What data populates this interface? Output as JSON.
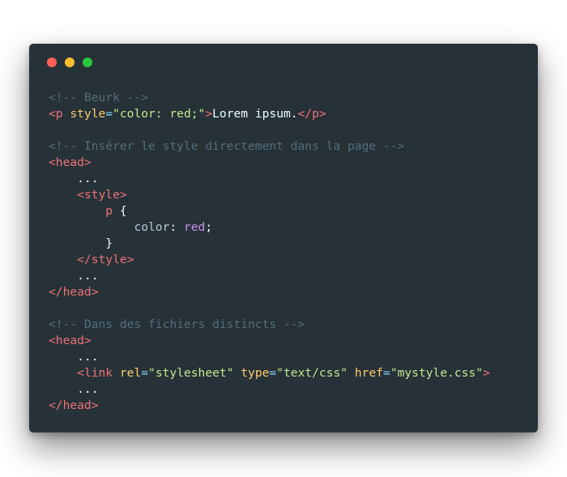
{
  "colors": {
    "background": "#263238",
    "close": "#ff5f56",
    "minimize": "#ffbd2e",
    "maximize": "#27c93f",
    "comment": "#546e7a",
    "tag": "#f07178",
    "attr": "#ffcb6b",
    "string": "#c3e88d",
    "text": "#eeffff",
    "property": "#b2ccd6",
    "value": "#c792ea",
    "punct": "#89ddff"
  },
  "window_controls": [
    "close",
    "minimize",
    "maximize"
  ],
  "code_lines": [
    [
      {
        "t": "<!-- Beurk -->",
        "c": "comment"
      }
    ],
    [
      {
        "t": "<p",
        "c": "tag"
      },
      {
        "t": " style",
        "c": "attr"
      },
      {
        "t": "=",
        "c": "punct"
      },
      {
        "t": "\"color: red;\"",
        "c": "string"
      },
      {
        "t": ">",
        "c": "tag"
      },
      {
        "t": "Lorem ipsum.",
        "c": "text"
      },
      {
        "t": "</p>",
        "c": "tag"
      }
    ],
    [],
    [
      {
        "t": "<!-- Insérer le style directement dans la page -->",
        "c": "comment"
      }
    ],
    [
      {
        "t": "<head>",
        "c": "tag"
      }
    ],
    [
      {
        "t": "    ...",
        "c": "text"
      }
    ],
    [
      {
        "t": "    ",
        "c": "text"
      },
      {
        "t": "<style>",
        "c": "tag"
      }
    ],
    [
      {
        "t": "        ",
        "c": "text"
      },
      {
        "t": "p",
        "c": "tag"
      },
      {
        "t": " {",
        "c": "text"
      }
    ],
    [
      {
        "t": "            ",
        "c": "text"
      },
      {
        "t": "color",
        "c": "property"
      },
      {
        "t": ": ",
        "c": "text"
      },
      {
        "t": "red",
        "c": "value"
      },
      {
        "t": ";",
        "c": "text"
      }
    ],
    [
      {
        "t": "        }",
        "c": "text"
      }
    ],
    [
      {
        "t": "    ",
        "c": "text"
      },
      {
        "t": "</style>",
        "c": "tag"
      }
    ],
    [
      {
        "t": "    ...",
        "c": "text"
      }
    ],
    [
      {
        "t": "</head>",
        "c": "tag"
      }
    ],
    [],
    [
      {
        "t": "<!-- Dans des fichiers distincts -->",
        "c": "comment"
      }
    ],
    [
      {
        "t": "<head>",
        "c": "tag"
      }
    ],
    [
      {
        "t": "    ...",
        "c": "text"
      }
    ],
    [
      {
        "t": "    ",
        "c": "text"
      },
      {
        "t": "<link",
        "c": "tag"
      },
      {
        "t": " rel",
        "c": "attr"
      },
      {
        "t": "=",
        "c": "punct"
      },
      {
        "t": "\"stylesheet\"",
        "c": "string"
      },
      {
        "t": " type",
        "c": "attr"
      },
      {
        "t": "=",
        "c": "punct"
      },
      {
        "t": "\"text/css\"",
        "c": "string"
      },
      {
        "t": " href",
        "c": "attr"
      },
      {
        "t": "=",
        "c": "punct"
      },
      {
        "t": "\"mystyle.css\"",
        "c": "string"
      },
      {
        "t": ">",
        "c": "tag"
      }
    ],
    [
      {
        "t": "    ...",
        "c": "text"
      }
    ],
    [
      {
        "t": "</head>",
        "c": "tag"
      }
    ]
  ]
}
